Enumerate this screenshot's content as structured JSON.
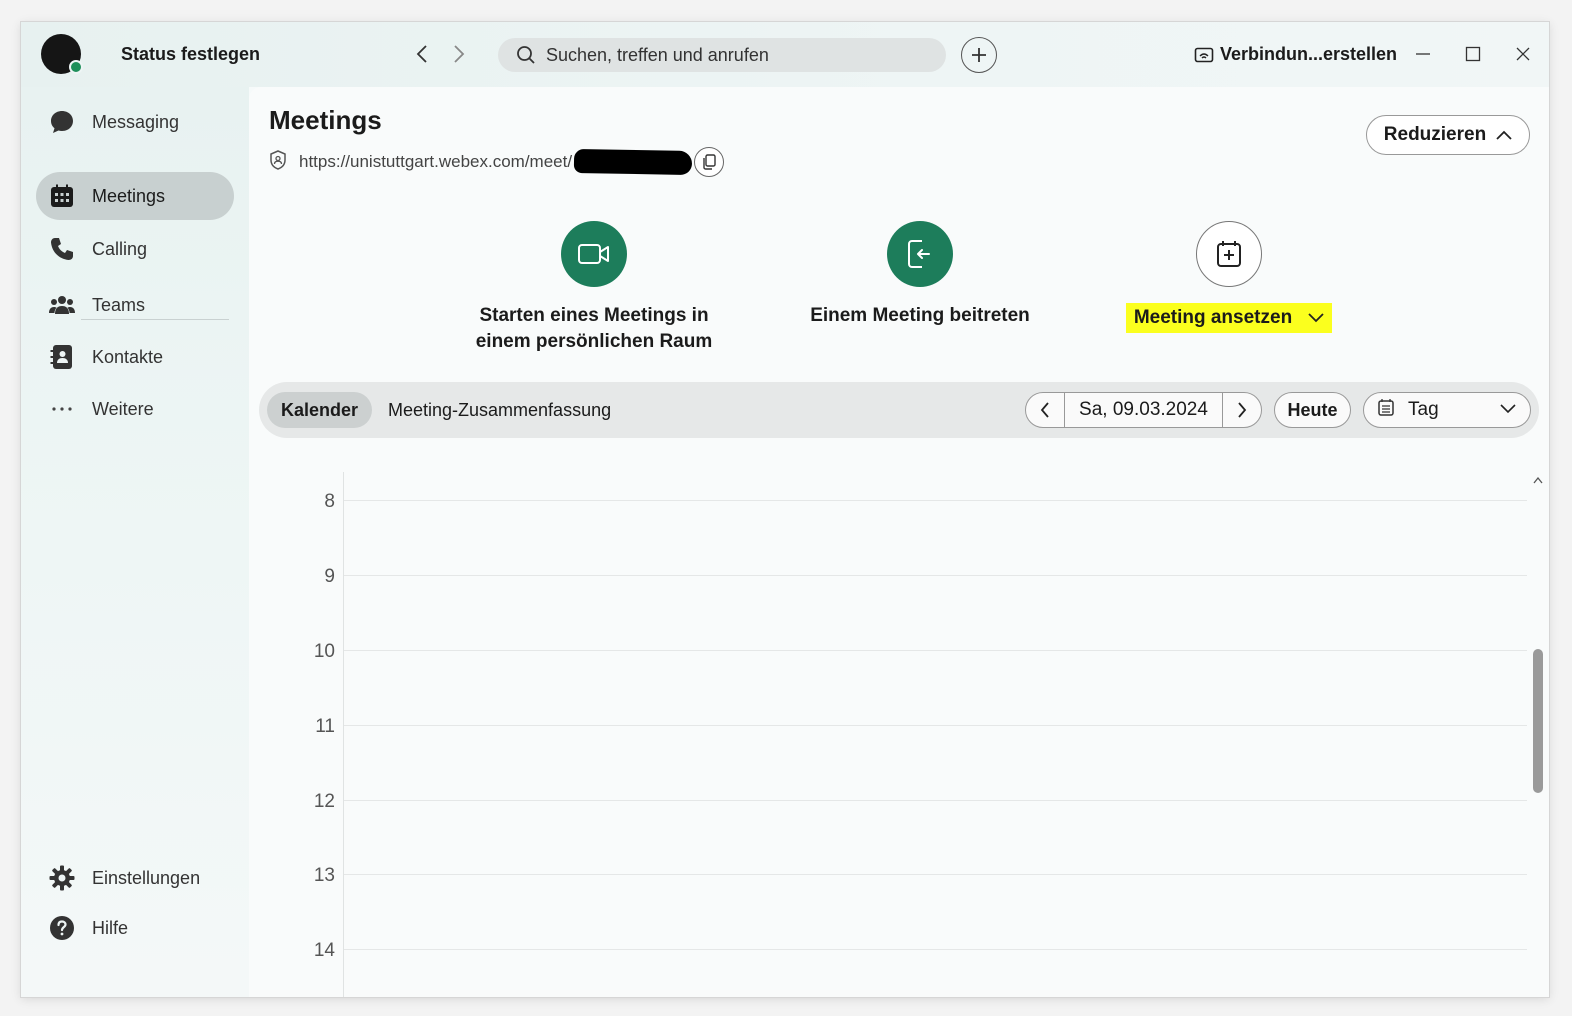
{
  "titlebar": {
    "status_label": "Status festlegen",
    "search_placeholder": "Suchen, treffen und anrufen",
    "connect_label": "Verbindun...erstellen"
  },
  "sidebar": {
    "items": [
      {
        "label": "Messaging",
        "icon": "chat-bubble-icon"
      },
      {
        "label": "Meetings",
        "icon": "calendar-grid-icon",
        "active": true
      },
      {
        "label": "Calling",
        "icon": "phone-icon"
      },
      {
        "label": "Teams",
        "icon": "people-icon"
      },
      {
        "label": "Kontakte",
        "icon": "contact-card-icon"
      },
      {
        "label": "Weitere",
        "icon": "more-dots-icon"
      }
    ],
    "bottom": [
      {
        "label": "Einstellungen",
        "icon": "gear-icon"
      },
      {
        "label": "Hilfe",
        "icon": "help-icon"
      }
    ]
  },
  "main": {
    "title": "Meetings",
    "url": "https://unistuttgart.webex.com/meet/",
    "reduce_label": "Reduzieren",
    "actions": {
      "start_line1": "Starten eines Meetings in",
      "start_line2": "einem persönlichen Raum",
      "join": "Einem Meeting beitreten",
      "schedule": "Meeting ansetzen"
    },
    "tabs": [
      "Kalender",
      "Meeting-Zusammenfassung"
    ],
    "active_tab": "Kalender",
    "date": "Sa, 09.03.2024",
    "today_label": "Heute",
    "view_label": "Tag",
    "hours": [
      "8",
      "9",
      "10",
      "11",
      "12",
      "13",
      "14"
    ]
  },
  "colors": {
    "accent_green": "#1d7d5b",
    "highlight_yellow": "#fbff1e",
    "presence_green": "#1e8f5a"
  }
}
